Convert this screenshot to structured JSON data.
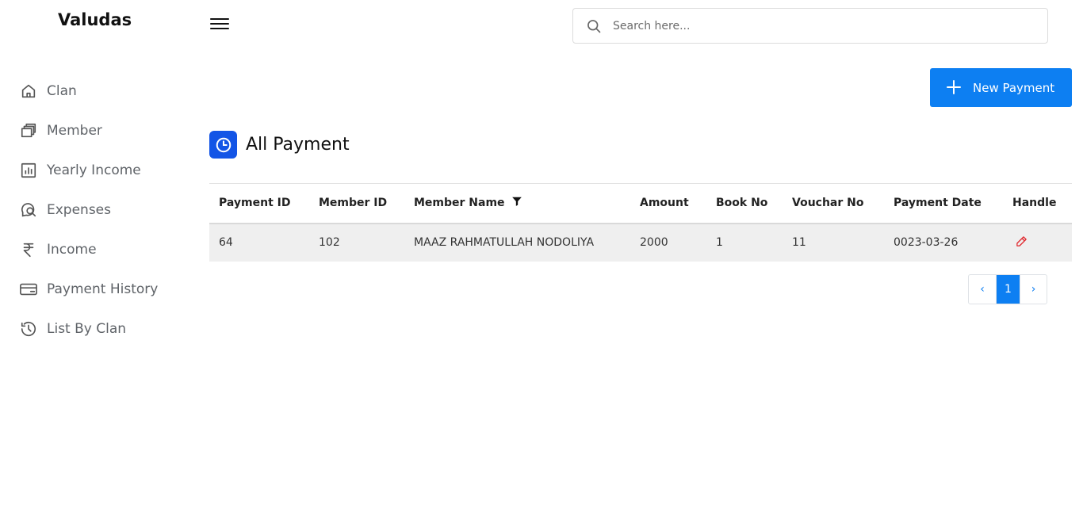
{
  "brand": "Valudas",
  "sidebar": {
    "items": [
      {
        "label": "Clan",
        "icon": "home-icon"
      },
      {
        "label": "Member",
        "icon": "wallet-icon"
      },
      {
        "label": "Yearly Income",
        "icon": "bar-chart-icon"
      },
      {
        "label": "Expenses",
        "icon": "search-chat-icon"
      },
      {
        "label": "Income",
        "icon": "rupee-icon"
      },
      {
        "label": "Payment History",
        "icon": "credit-card-icon"
      },
      {
        "label": "List By Clan",
        "icon": "history-icon"
      }
    ]
  },
  "search": {
    "placeholder": "Search here..."
  },
  "actions": {
    "new_payment_label": "New Payment"
  },
  "section": {
    "title": "All Payment",
    "icon": "clock-icon"
  },
  "table": {
    "headers": [
      "Payment ID",
      "Member ID",
      "Member Name",
      "Amount",
      "Book No",
      "Vouchar No",
      "Payment Date",
      "Handle"
    ],
    "rows": [
      {
        "payment_id": "64",
        "member_id": "102",
        "member_name": "MAAZ RAHMATULLAH NODOLIYA",
        "amount": "2000",
        "book_no": "1",
        "vouchar_no": "11",
        "payment_date": "0023-03-26"
      }
    ]
  },
  "pagination": {
    "prev": "‹",
    "current": "1",
    "next": "›"
  },
  "colors": {
    "primary": "#0d7ff2",
    "accent_badge": "#1355e6",
    "row_bg": "#efefef",
    "edit_icon": "#e0262c"
  }
}
